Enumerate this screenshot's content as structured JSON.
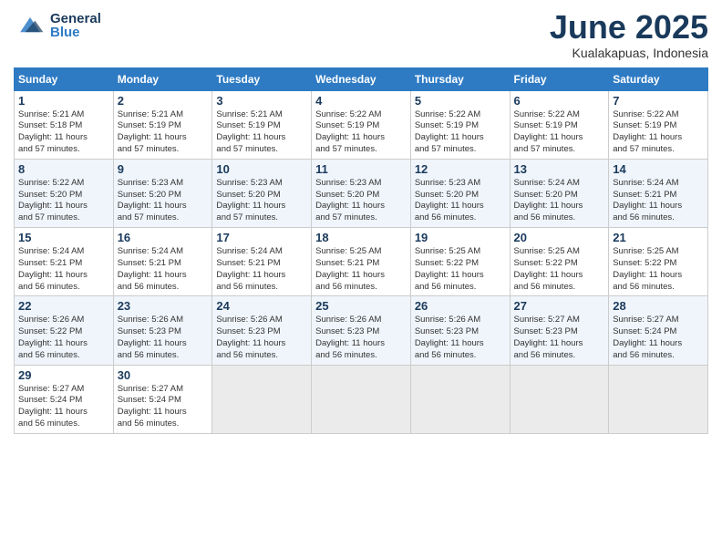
{
  "header": {
    "logo_general": "General",
    "logo_blue": "Blue",
    "month_title": "June 2025",
    "subtitle": "Kualakapuas, Indonesia"
  },
  "columns": [
    "Sunday",
    "Monday",
    "Tuesday",
    "Wednesday",
    "Thursday",
    "Friday",
    "Saturday"
  ],
  "weeks": [
    [
      {
        "day": "1",
        "info": "Sunrise: 5:21 AM\nSunset: 5:18 PM\nDaylight: 11 hours\nand 57 minutes."
      },
      {
        "day": "2",
        "info": "Sunrise: 5:21 AM\nSunset: 5:19 PM\nDaylight: 11 hours\nand 57 minutes."
      },
      {
        "day": "3",
        "info": "Sunrise: 5:21 AM\nSunset: 5:19 PM\nDaylight: 11 hours\nand 57 minutes."
      },
      {
        "day": "4",
        "info": "Sunrise: 5:22 AM\nSunset: 5:19 PM\nDaylight: 11 hours\nand 57 minutes."
      },
      {
        "day": "5",
        "info": "Sunrise: 5:22 AM\nSunset: 5:19 PM\nDaylight: 11 hours\nand 57 minutes."
      },
      {
        "day": "6",
        "info": "Sunrise: 5:22 AM\nSunset: 5:19 PM\nDaylight: 11 hours\nand 57 minutes."
      },
      {
        "day": "7",
        "info": "Sunrise: 5:22 AM\nSunset: 5:19 PM\nDaylight: 11 hours\nand 57 minutes."
      }
    ],
    [
      {
        "day": "8",
        "info": "Sunrise: 5:22 AM\nSunset: 5:20 PM\nDaylight: 11 hours\nand 57 minutes."
      },
      {
        "day": "9",
        "info": "Sunrise: 5:23 AM\nSunset: 5:20 PM\nDaylight: 11 hours\nand 57 minutes."
      },
      {
        "day": "10",
        "info": "Sunrise: 5:23 AM\nSunset: 5:20 PM\nDaylight: 11 hours\nand 57 minutes."
      },
      {
        "day": "11",
        "info": "Sunrise: 5:23 AM\nSunset: 5:20 PM\nDaylight: 11 hours\nand 57 minutes."
      },
      {
        "day": "12",
        "info": "Sunrise: 5:23 AM\nSunset: 5:20 PM\nDaylight: 11 hours\nand 56 minutes."
      },
      {
        "day": "13",
        "info": "Sunrise: 5:24 AM\nSunset: 5:20 PM\nDaylight: 11 hours\nand 56 minutes."
      },
      {
        "day": "14",
        "info": "Sunrise: 5:24 AM\nSunset: 5:21 PM\nDaylight: 11 hours\nand 56 minutes."
      }
    ],
    [
      {
        "day": "15",
        "info": "Sunrise: 5:24 AM\nSunset: 5:21 PM\nDaylight: 11 hours\nand 56 minutes."
      },
      {
        "day": "16",
        "info": "Sunrise: 5:24 AM\nSunset: 5:21 PM\nDaylight: 11 hours\nand 56 minutes."
      },
      {
        "day": "17",
        "info": "Sunrise: 5:24 AM\nSunset: 5:21 PM\nDaylight: 11 hours\nand 56 minutes."
      },
      {
        "day": "18",
        "info": "Sunrise: 5:25 AM\nSunset: 5:21 PM\nDaylight: 11 hours\nand 56 minutes."
      },
      {
        "day": "19",
        "info": "Sunrise: 5:25 AM\nSunset: 5:22 PM\nDaylight: 11 hours\nand 56 minutes."
      },
      {
        "day": "20",
        "info": "Sunrise: 5:25 AM\nSunset: 5:22 PM\nDaylight: 11 hours\nand 56 minutes."
      },
      {
        "day": "21",
        "info": "Sunrise: 5:25 AM\nSunset: 5:22 PM\nDaylight: 11 hours\nand 56 minutes."
      }
    ],
    [
      {
        "day": "22",
        "info": "Sunrise: 5:26 AM\nSunset: 5:22 PM\nDaylight: 11 hours\nand 56 minutes."
      },
      {
        "day": "23",
        "info": "Sunrise: 5:26 AM\nSunset: 5:23 PM\nDaylight: 11 hours\nand 56 minutes."
      },
      {
        "day": "24",
        "info": "Sunrise: 5:26 AM\nSunset: 5:23 PM\nDaylight: 11 hours\nand 56 minutes."
      },
      {
        "day": "25",
        "info": "Sunrise: 5:26 AM\nSunset: 5:23 PM\nDaylight: 11 hours\nand 56 minutes."
      },
      {
        "day": "26",
        "info": "Sunrise: 5:26 AM\nSunset: 5:23 PM\nDaylight: 11 hours\nand 56 minutes."
      },
      {
        "day": "27",
        "info": "Sunrise: 5:27 AM\nSunset: 5:23 PM\nDaylight: 11 hours\nand 56 minutes."
      },
      {
        "day": "28",
        "info": "Sunrise: 5:27 AM\nSunset: 5:24 PM\nDaylight: 11 hours\nand 56 minutes."
      }
    ],
    [
      {
        "day": "29",
        "info": "Sunrise: 5:27 AM\nSunset: 5:24 PM\nDaylight: 11 hours\nand 56 minutes."
      },
      {
        "day": "30",
        "info": "Sunrise: 5:27 AM\nSunset: 5:24 PM\nDaylight: 11 hours\nand 56 minutes."
      },
      {
        "day": "",
        "info": ""
      },
      {
        "day": "",
        "info": ""
      },
      {
        "day": "",
        "info": ""
      },
      {
        "day": "",
        "info": ""
      },
      {
        "day": "",
        "info": ""
      }
    ]
  ]
}
